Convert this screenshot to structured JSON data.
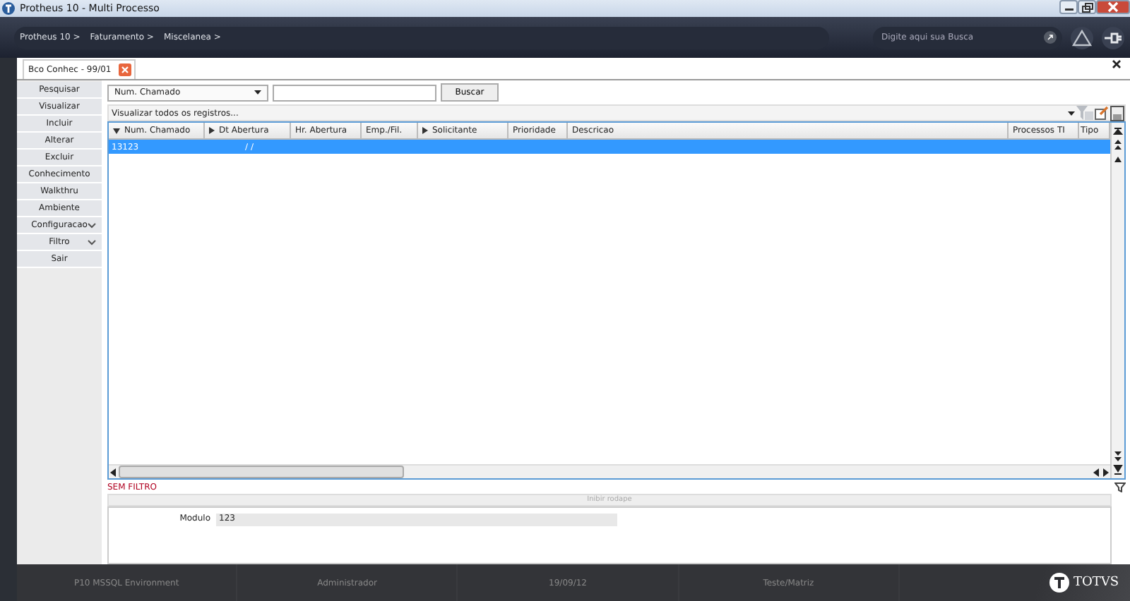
{
  "window": {
    "title": "Protheus 10 - Multi Processo"
  },
  "breadcrumbs": [
    "Protheus 10 >",
    "Faturamento >",
    "Miscelanea >"
  ],
  "search": {
    "placeholder": "Digite aqui sua Busca"
  },
  "tabs": [
    {
      "label": "Bco Conhec - 99/01",
      "selected": true
    }
  ],
  "sidebar": {
    "items": [
      {
        "label": "Pesquisar",
        "expandable": false
      },
      {
        "label": "Visualizar",
        "expandable": false
      },
      {
        "label": "Incluir",
        "expandable": false
      },
      {
        "label": "Alterar",
        "expandable": false
      },
      {
        "label": "Excluir",
        "expandable": false
      },
      {
        "label": "Conhecimento",
        "expandable": false
      },
      {
        "label": "Walkthru",
        "expandable": false
      },
      {
        "label": "Ambiente",
        "expandable": false
      },
      {
        "label": "Configuracao",
        "expandable": true
      },
      {
        "label": "Filtro",
        "expandable": true
      },
      {
        "label": "Sair",
        "expandable": false
      }
    ]
  },
  "search_bar": {
    "field_select": "Num. Chamado",
    "button": "Buscar"
  },
  "view_bar": {
    "label": "Visualizar todos os registros..."
  },
  "table": {
    "columns": [
      {
        "label": "Num. Chamado",
        "sorted": true,
        "expandable": false
      },
      {
        "label": "Dt Abertura",
        "sorted": false,
        "expandable": true
      },
      {
        "label": "Hr. Abertura",
        "sorted": false,
        "expandable": false
      },
      {
        "label": "Emp./Fil.",
        "sorted": false,
        "expandable": false
      },
      {
        "label": "Solicitante",
        "sorted": false,
        "expandable": true
      },
      {
        "label": "Prioridade",
        "sorted": false,
        "expandable": false
      },
      {
        "label": "Descricao",
        "sorted": false,
        "expandable": false
      },
      {
        "label": "Processos TI",
        "sorted": false,
        "expandable": false
      },
      {
        "label": "Tipo",
        "sorted": false,
        "expandable": false
      }
    ],
    "rows": [
      {
        "selected": true,
        "cells": [
          "13123",
          "/ /",
          "",
          "",
          "",
          "",
          "",
          "",
          ""
        ]
      }
    ]
  },
  "filter_status": "SEM FILTRO",
  "footer_toggle": "Inibir rodape",
  "detail": {
    "label": "Modulo",
    "value": "123"
  },
  "status_bar": [
    "P10 MSSQL Environment",
    "Administrador",
    "19/09/12",
    "Teste/Matriz"
  ],
  "brand": "TOTVS"
}
